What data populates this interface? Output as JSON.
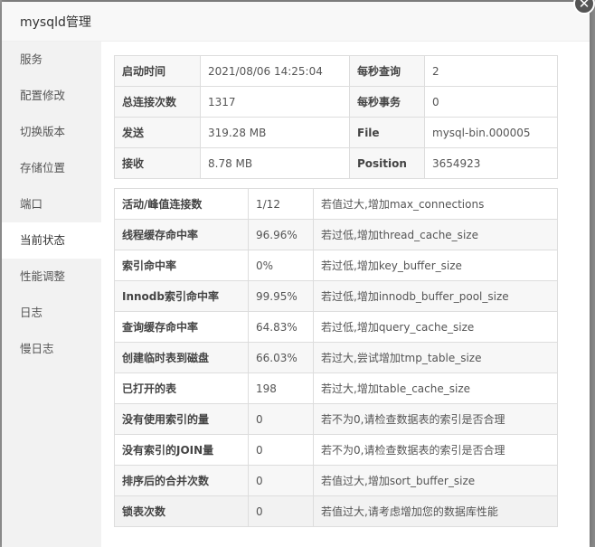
{
  "dialog": {
    "title": "mysqld管理",
    "close_glyph": "✕"
  },
  "sidebar": {
    "items": [
      {
        "label": "服务"
      },
      {
        "label": "配置修改"
      },
      {
        "label": "切换版本"
      },
      {
        "label": "存储位置"
      },
      {
        "label": "端口"
      },
      {
        "label": "当前状态",
        "active": true
      },
      {
        "label": "性能调整"
      },
      {
        "label": "日志"
      },
      {
        "label": "慢日志"
      }
    ]
  },
  "summary": {
    "rows": [
      {
        "k1": "启动时间",
        "v1": "2021/08/06 14:25:04",
        "k2": "每秒查询",
        "v2": "2"
      },
      {
        "k1": "总连接次数",
        "v1": "1317",
        "k2": "每秒事务",
        "v2": "0"
      },
      {
        "k1": "发送",
        "v1": "319.28 MB",
        "k2": "File",
        "v2": "mysql-bin.000005"
      },
      {
        "k1": "接收",
        "v1": "8.78 MB",
        "k2": "Position",
        "v2": "3654923"
      }
    ]
  },
  "metrics": {
    "rows": [
      {
        "name": "活动/峰值连接数",
        "value": "1/12",
        "tip": "若值过大,增加max_connections"
      },
      {
        "name": "线程缓存命中率",
        "value": "96.96%",
        "tip": "若过低,增加thread_cache_size"
      },
      {
        "name": "索引命中率",
        "value": "0%",
        "tip": "若过低,增加key_buffer_size"
      },
      {
        "name": "Innodb索引命中率",
        "value": "99.95%",
        "tip": "若过低,增加innodb_buffer_pool_size"
      },
      {
        "name": "查询缓存命中率",
        "value": "64.83%",
        "tip": "若过低,增加query_cache_size"
      },
      {
        "name": "创建临时表到磁盘",
        "value": "66.03%",
        "tip": "若过大,尝试增加tmp_table_size"
      },
      {
        "name": "已打开的表",
        "value": "198",
        "tip": "若过大,增加table_cache_size"
      },
      {
        "name": "没有使用索引的量",
        "value": "0",
        "tip": "若不为0,请检查数据表的索引是否合理"
      },
      {
        "name": "没有索引的JOIN量",
        "value": "0",
        "tip": "若不为0,请检查数据表的索引是否合理"
      },
      {
        "name": "排序后的合并次数",
        "value": "0",
        "tip": "若值过大,增加sort_buffer_size"
      },
      {
        "name": "锁表次数",
        "value": "0",
        "tip": "若值过大,请考虑增加您的数据库性能"
      }
    ]
  }
}
